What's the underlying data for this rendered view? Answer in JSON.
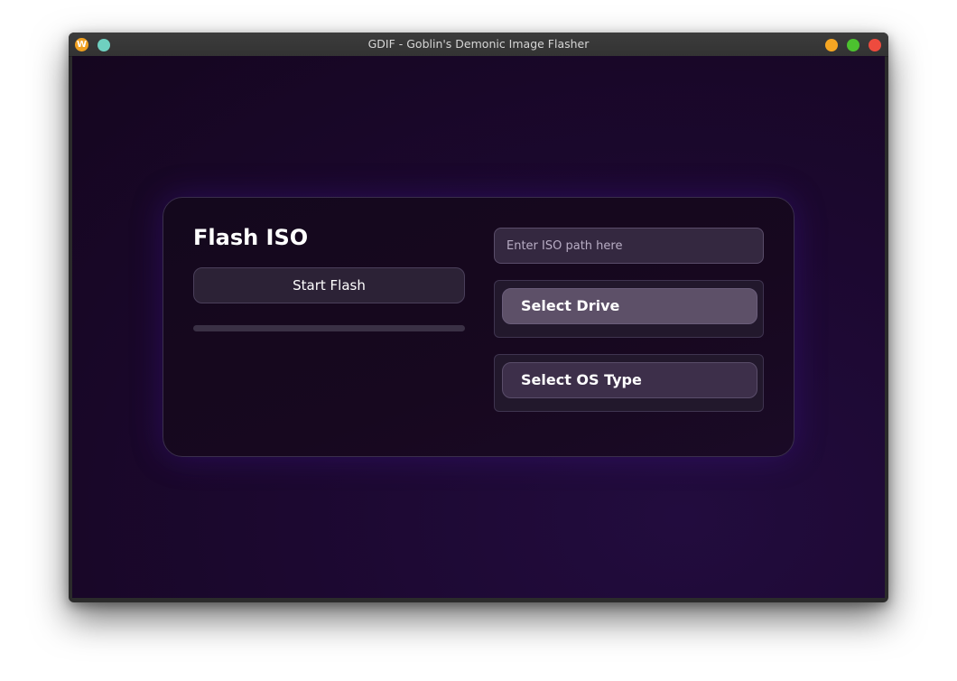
{
  "window": {
    "title": "GDIF - Goblin's Demonic Image Flasher",
    "app_icon_letter": "W",
    "colors": {
      "app_icon": "#f0a020",
      "sticky": "#6fd0c0",
      "minimize": "#f5a623",
      "maximize": "#4cc22f",
      "close": "#ee4b3e"
    }
  },
  "panel": {
    "heading": "Flash ISO",
    "start_button": "Start Flash",
    "progress": 0,
    "iso_input": {
      "value": "",
      "placeholder": "Enter ISO path here"
    },
    "select_drive": "Select Drive",
    "select_os": "Select OS Type"
  }
}
